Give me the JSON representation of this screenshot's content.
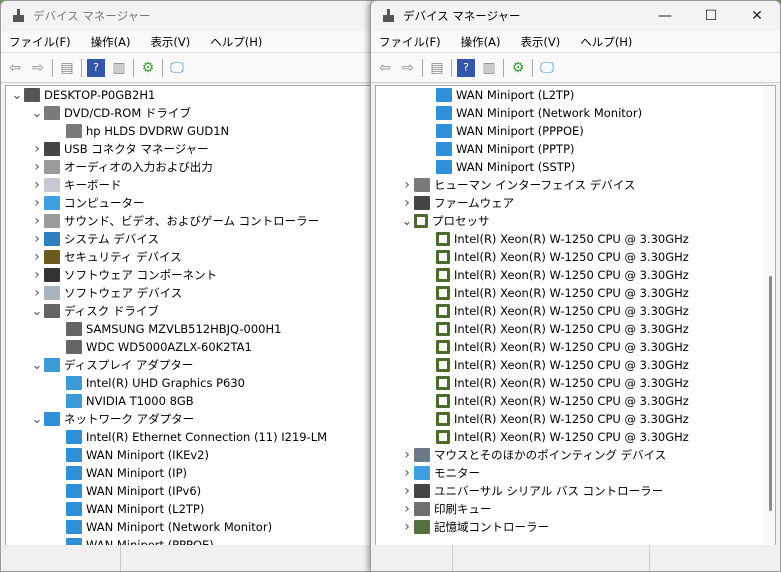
{
  "title": "デバイス マネージャー",
  "menu": [
    "ファイル(F)",
    "操作(A)",
    "表示(V)",
    "ヘルプ(H)"
  ],
  "window_controls": {
    "minimize": "—",
    "maximize": "☐",
    "close": "✕"
  },
  "left_tree": [
    {
      "level": 0,
      "chev": "v",
      "icon": "computer",
      "label": "DESKTOP-P0GB2H1"
    },
    {
      "level": 1,
      "chev": "v",
      "icon": "dvd",
      "label": "DVD/CD-ROM ドライブ"
    },
    {
      "level": 2,
      "icon": "dvd",
      "label": "hp HLDS DVDRW  GUD1N"
    },
    {
      "level": 1,
      "chev": ">",
      "icon": "usb",
      "label": "USB コネクタ マネージャー"
    },
    {
      "level": 1,
      "chev": ">",
      "icon": "audio",
      "label": "オーディオの入力および出力"
    },
    {
      "level": 1,
      "chev": ">",
      "icon": "keyboard",
      "label": "キーボード"
    },
    {
      "level": 1,
      "chev": ">",
      "icon": "monitor",
      "label": "コンピューター"
    },
    {
      "level": 1,
      "chev": ">",
      "icon": "audio",
      "label": "サウンド、ビデオ、およびゲーム コントローラー"
    },
    {
      "level": 1,
      "chev": ">",
      "icon": "system",
      "label": "システム デバイス"
    },
    {
      "level": 1,
      "chev": ">",
      "icon": "security",
      "label": "セキュリティ デバイス"
    },
    {
      "level": 1,
      "chev": ">",
      "icon": "software",
      "label": "ソフトウェア コンポーネント"
    },
    {
      "level": 1,
      "chev": ">",
      "icon": "softdev",
      "label": "ソフトウェア デバイス"
    },
    {
      "level": 1,
      "chev": "v",
      "icon": "disk",
      "label": "ディスク ドライブ"
    },
    {
      "level": 2,
      "icon": "disk",
      "label": "SAMSUNG MZVLB512HBJQ-000H1"
    },
    {
      "level": 2,
      "icon": "disk",
      "label": "WDC WD5000AZLX-60K2TA1"
    },
    {
      "level": 1,
      "chev": "v",
      "icon": "display",
      "label": "ディスプレイ アダプター"
    },
    {
      "level": 2,
      "icon": "display",
      "label": "Intel(R) UHD Graphics P630"
    },
    {
      "level": 2,
      "icon": "display",
      "label": "NVIDIA T1000 8GB"
    },
    {
      "level": 1,
      "chev": "v",
      "icon": "network",
      "label": "ネットワーク アダプター"
    },
    {
      "level": 2,
      "icon": "network",
      "label": "Intel(R) Ethernet Connection (11) I219-LM"
    },
    {
      "level": 2,
      "icon": "network",
      "label": "WAN Miniport (IKEv2)"
    },
    {
      "level": 2,
      "icon": "network",
      "label": "WAN Miniport (IP)"
    },
    {
      "level": 2,
      "icon": "network",
      "label": "WAN Miniport (IPv6)"
    },
    {
      "level": 2,
      "icon": "network",
      "label": "WAN Miniport (L2TP)"
    },
    {
      "level": 2,
      "icon": "network",
      "label": "WAN Miniport (Network Monitor)"
    },
    {
      "level": 2,
      "icon": "network",
      "label": "WAN Miniport (PPPOE)"
    }
  ],
  "right_tree": [
    {
      "level": 2,
      "icon": "network",
      "label": "WAN Miniport (L2TP)"
    },
    {
      "level": 2,
      "icon": "network",
      "label": "WAN Miniport (Network Monitor)"
    },
    {
      "level": 2,
      "icon": "network",
      "label": "WAN Miniport (PPPOE)"
    },
    {
      "level": 2,
      "icon": "network",
      "label": "WAN Miniport (PPTP)"
    },
    {
      "level": 2,
      "icon": "network",
      "label": "WAN Miniport (SSTP)"
    },
    {
      "level": 1,
      "chev": ">",
      "icon": "hid",
      "label": "ヒューマン インターフェイス デバイス"
    },
    {
      "level": 1,
      "chev": ">",
      "icon": "firmware",
      "label": "ファームウェア"
    },
    {
      "level": 1,
      "chev": "v",
      "icon": "cpu",
      "label": "プロセッサ"
    },
    {
      "level": 2,
      "icon": "cpu",
      "label": "Intel(R) Xeon(R) W-1250 CPU @ 3.30GHz"
    },
    {
      "level": 2,
      "icon": "cpu",
      "label": "Intel(R) Xeon(R) W-1250 CPU @ 3.30GHz"
    },
    {
      "level": 2,
      "icon": "cpu",
      "label": "Intel(R) Xeon(R) W-1250 CPU @ 3.30GHz"
    },
    {
      "level": 2,
      "icon": "cpu",
      "label": "Intel(R) Xeon(R) W-1250 CPU @ 3.30GHz"
    },
    {
      "level": 2,
      "icon": "cpu",
      "label": "Intel(R) Xeon(R) W-1250 CPU @ 3.30GHz"
    },
    {
      "level": 2,
      "icon": "cpu",
      "label": "Intel(R) Xeon(R) W-1250 CPU @ 3.30GHz"
    },
    {
      "level": 2,
      "icon": "cpu",
      "label": "Intel(R) Xeon(R) W-1250 CPU @ 3.30GHz"
    },
    {
      "level": 2,
      "icon": "cpu",
      "label": "Intel(R) Xeon(R) W-1250 CPU @ 3.30GHz"
    },
    {
      "level": 2,
      "icon": "cpu",
      "label": "Intel(R) Xeon(R) W-1250 CPU @ 3.30GHz"
    },
    {
      "level": 2,
      "icon": "cpu",
      "label": "Intel(R) Xeon(R) W-1250 CPU @ 3.30GHz"
    },
    {
      "level": 2,
      "icon": "cpu",
      "label": "Intel(R) Xeon(R) W-1250 CPU @ 3.30GHz"
    },
    {
      "level": 2,
      "icon": "cpu",
      "label": "Intel(R) Xeon(R) W-1250 CPU @ 3.30GHz"
    },
    {
      "level": 1,
      "chev": ">",
      "icon": "mouse",
      "label": "マウスとそのほかのポインティング デバイス"
    },
    {
      "level": 1,
      "chev": ">",
      "icon": "monitor",
      "label": "モニター"
    },
    {
      "level": 1,
      "chev": ">",
      "icon": "usb",
      "label": "ユニバーサル シリアル バス コントローラー"
    },
    {
      "level": 1,
      "chev": ">",
      "icon": "printer",
      "label": "印刷キュー"
    },
    {
      "level": 1,
      "chev": ">",
      "icon": "storage",
      "label": "記憶域コントローラー"
    }
  ],
  "icon_colors": {
    "computer": "#555555",
    "dvd": "#7a7a7a",
    "usb": "#444444",
    "audio": "#9a9a9a",
    "keyboard": "#c8c8d0",
    "monitor": "#3ea0e0",
    "system": "#2e7fc0",
    "security": "#6b5a20",
    "software": "#333333",
    "softdev": "#a8b4c0",
    "disk": "#666666",
    "display": "#3c9ad8",
    "network": "#2f8fd8",
    "hid": "#7a7a7a",
    "firmware": "#444444",
    "cpu": "#4a6a30",
    "mouse": "#6a7a8a",
    "printer": "#707070",
    "storage": "#557040"
  }
}
